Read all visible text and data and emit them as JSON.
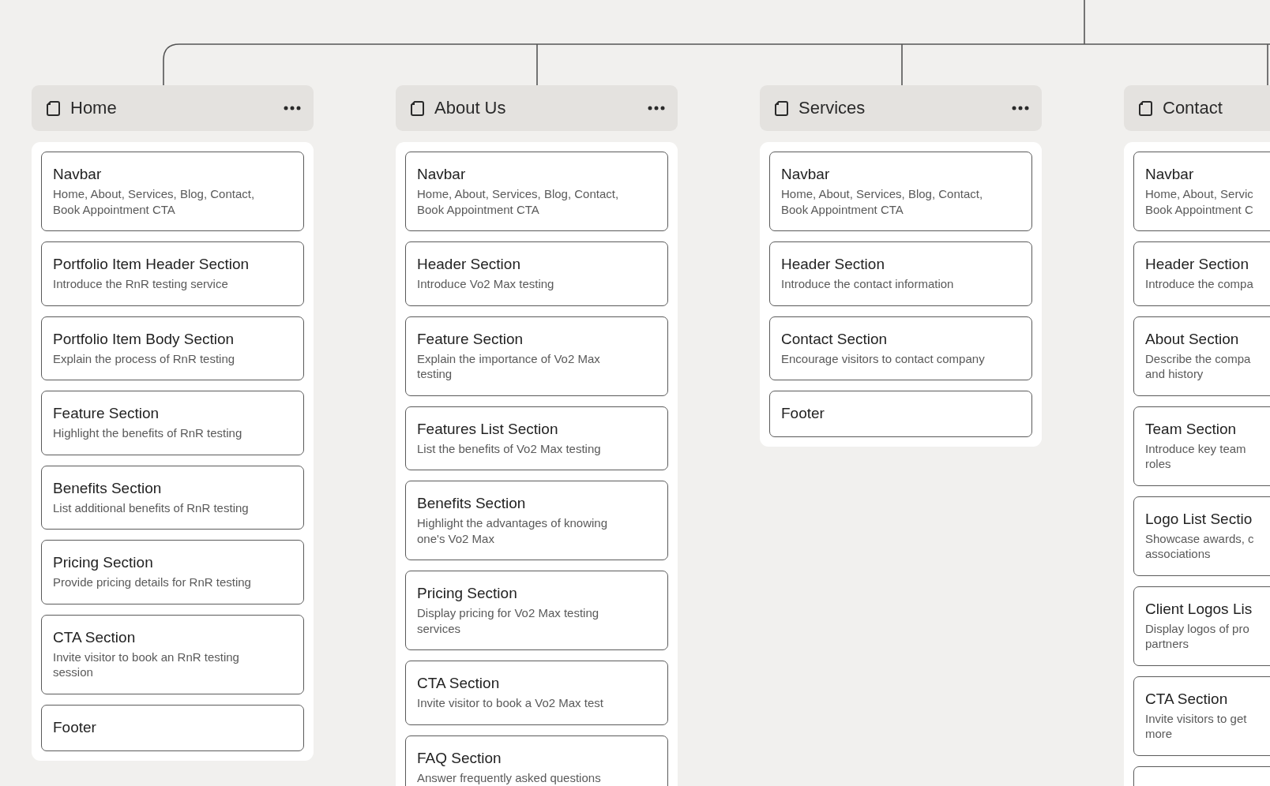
{
  "pages": [
    {
      "title": "Home",
      "more_button": true,
      "sections": [
        {
          "kind": "card",
          "title": "Navbar",
          "description": "Home, About, Services, Blog, Contact,\nBook Appointment CTA"
        },
        {
          "kind": "card",
          "title": "Portfolio Item Header Section",
          "description": "Introduce the RnR testing service"
        },
        {
          "kind": "card",
          "title": "Portfolio Item Body Section",
          "description": "Explain the process of RnR testing"
        },
        {
          "kind": "card",
          "title": "Feature Section",
          "description": "Highlight the benefits of RnR testing"
        },
        {
          "kind": "card",
          "title": "Benefits Section",
          "description": "List additional benefits of RnR testing"
        },
        {
          "kind": "card",
          "title": "Pricing Section",
          "description": "Provide pricing details for RnR testing"
        },
        {
          "kind": "card",
          "title": "CTA Section",
          "description": "Invite visitor to book an RnR testing\nsession"
        },
        {
          "kind": "card",
          "title": "Footer"
        }
      ]
    },
    {
      "title": "About Us",
      "more_button": true,
      "sections": [
        {
          "kind": "card",
          "title": "Navbar",
          "description": "Home, About, Services, Blog, Contact,\nBook Appointment CTA"
        },
        {
          "kind": "card",
          "title": "Header Section",
          "description": "Introduce Vo2 Max testing"
        },
        {
          "kind": "card",
          "title": "Feature Section",
          "description": "Explain the importance of Vo2 Max\ntesting"
        },
        {
          "kind": "card",
          "title": "Features List Section",
          "description": "List the benefits of Vo2 Max testing"
        },
        {
          "kind": "card",
          "title": "Benefits Section",
          "description": "Highlight the advantages of knowing\none's Vo2 Max"
        },
        {
          "kind": "card",
          "title": "Pricing Section",
          "description": "Display pricing for Vo2 Max testing\nservices"
        },
        {
          "kind": "card",
          "title": "CTA Section",
          "description": "Invite visitor to book a Vo2 Max test"
        },
        {
          "kind": "card",
          "title": "FAQ Section",
          "description": "Answer frequently asked questions"
        }
      ]
    },
    {
      "title": "Services",
      "more_button": true,
      "sections": [
        {
          "kind": "card",
          "title": "Navbar",
          "description": "Home, About, Services, Blog, Contact,\nBook Appointment CTA"
        },
        {
          "kind": "card",
          "title": "Header Section",
          "description": "Introduce the contact information"
        },
        {
          "kind": "card",
          "title": "Contact Section",
          "description": "Encourage visitors to contact company"
        },
        {
          "kind": "card",
          "title": "Footer"
        }
      ]
    },
    {
      "title": "Contact",
      "more_button": false,
      "sections": [
        {
          "kind": "card",
          "title": "Navbar",
          "description": "Home, About, Servic\nBook Appointment C"
        },
        {
          "kind": "card",
          "title": "Header Section",
          "description": "Introduce the compa"
        },
        {
          "kind": "card",
          "title": "About Section",
          "description": "Describe the compa\nand history"
        },
        {
          "kind": "card",
          "title": "Team Section",
          "description": "Introduce key team\nroles"
        },
        {
          "kind": "card",
          "title": "Logo List Sectio",
          "description": "Showcase awards, c\nassociations"
        },
        {
          "kind": "card",
          "title": "Client Logos Lis",
          "description": "Display logos of pro\npartners"
        },
        {
          "kind": "card",
          "title": "CTA Section",
          "description": "Invite visitors to get\nmore"
        },
        {
          "kind": "clipped"
        }
      ]
    }
  ]
}
